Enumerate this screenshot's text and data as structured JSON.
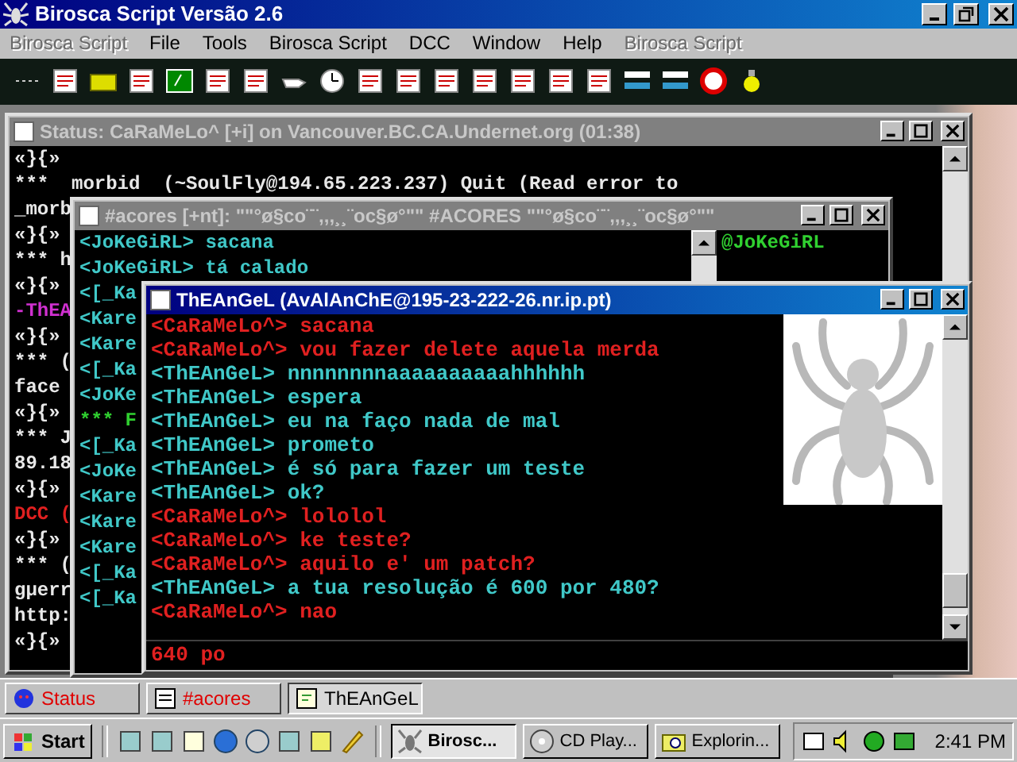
{
  "app": {
    "title": "Birosca Script Versão 2.6"
  },
  "menu": [
    {
      "label": "Birosca Script",
      "disabled": true
    },
    {
      "label": "File",
      "disabled": false
    },
    {
      "label": "Tools",
      "disabled": false
    },
    {
      "label": "Birosca Script",
      "disabled": false
    },
    {
      "label": "DCC",
      "disabled": false
    },
    {
      "label": "Window",
      "disabled": false
    },
    {
      "label": "Help",
      "disabled": false
    },
    {
      "label": "Birosca Script",
      "disabled": true
    }
  ],
  "status_window": {
    "title": "Status: CaRaMeLo^ [+i] on Vancouver.BC.CA.Undernet.org (01:38)",
    "active": false,
    "lines": [
      {
        "text": "«}{»",
        "color": "#e8e8e8"
      },
      {
        "text": "***  morbid  (~SoulFly@194.65.223.237) Quit (Read error to",
        "color": "#e8e8e8"
      },
      {
        "text": "_morb",
        "color": "#e8e8e8"
      },
      {
        "text": "«}{»",
        "color": "#e8e8e8"
      },
      {
        "text": "*** h",
        "color": "#e8e8e8"
      },
      {
        "text": "«}{»",
        "color": "#e8e8e8"
      },
      {
        "text": "-ThEA",
        "color": "#d030d0"
      },
      {
        "text": "«}{»",
        "color": "#e8e8e8"
      },
      {
        "text": "*** (",
        "color": "#e8e8e8"
      },
      {
        "text": "face",
        "color": "#e8e8e8"
      },
      {
        "text": "«}{»",
        "color": "#e8e8e8"
      },
      {
        "text": "*** J",
        "color": "#e8e8e8"
      },
      {
        "text": "89.18",
        "color": "#e8e8e8"
      },
      {
        "text": "«}{»",
        "color": "#e8e8e8"
      },
      {
        "text": "DCC (",
        "color": "#e02020"
      },
      {
        "text": "«}{»",
        "color": "#e8e8e8"
      },
      {
        "text": "*** (",
        "color": "#e8e8e8"
      },
      {
        "text": "gμerr",
        "color": "#e8e8e8"
      },
      {
        "text": "http:",
        "color": "#e8e8e8"
      },
      {
        "text": "«}{»",
        "color": "#e8e8e8"
      }
    ]
  },
  "channel_window": {
    "title": "#acores [+nt]: \"\"°ø§co¨¨,,,¸¸¨oc§ø°\"\" #ACORES \"\"°ø§co¨¨,,,¸¸¨oc§ø°\"\"",
    "active": false,
    "lines": [
      {
        "text": "<JoKeGiRL> sacana",
        "color": "#40c8c8"
      },
      {
        "text": "<JoKeGiRL> tá calado",
        "color": "#40c8c8"
      },
      {
        "text": "<[_Ka",
        "color": "#40c8c8"
      },
      {
        "text": "<Kare",
        "color": "#40c8c8"
      },
      {
        "text": "<Kare",
        "color": "#40c8c8"
      },
      {
        "text": "<[_Ka",
        "color": "#40c8c8"
      },
      {
        "text": "<JoKe",
        "color": "#40c8c8"
      },
      {
        "text": "*** F",
        "color": "#30d030"
      },
      {
        "text": "<[_Ka",
        "color": "#40c8c8"
      },
      {
        "text": "<JoKe",
        "color": "#40c8c8"
      },
      {
        "text": "<Kare",
        "color": "#40c8c8"
      },
      {
        "text": "<Kare",
        "color": "#40c8c8"
      },
      {
        "text": "<Kare",
        "color": "#40c8c8"
      },
      {
        "text": "<[_Ka",
        "color": "#40c8c8"
      },
      {
        "text": "<[_Ka",
        "color": "#40c8c8"
      }
    ],
    "nicklist": [
      {
        "nick": "@JoKeGiRL",
        "selected": false
      }
    ]
  },
  "query_window": {
    "title": "ThEAnGeL (AvAlAnChE@195-23-222-26.nr.ip.pt)",
    "active": true,
    "lines": [
      {
        "text": "<CaRaMeLo^> sacana",
        "color": "#e02020"
      },
      {
        "text": "<CaRaMeLo^> vou fazer delete aquela merda",
        "color": "#e02020"
      },
      {
        "text": "<ThEAnGeL> nnnnnnnnaaaaaaaaaahhhhhh",
        "color": "#40c8c8"
      },
      {
        "text": "<ThEAnGeL> espera",
        "color": "#40c8c8"
      },
      {
        "text": "<ThEAnGeL> eu na faço nada de mal",
        "color": "#40c8c8"
      },
      {
        "text": "<ThEAnGeL> prometo",
        "color": "#40c8c8"
      },
      {
        "text": "<ThEAnGeL> é só para fazer um teste",
        "color": "#40c8c8"
      },
      {
        "text": "<ThEAnGeL> ok?",
        "color": "#40c8c8"
      },
      {
        "text": "<CaRaMeLo^> lololol",
        "color": "#e02020"
      },
      {
        "text": "<CaRaMeLo^> ke teste?",
        "color": "#e02020"
      },
      {
        "text": "<CaRaMeLo^> aquilo e' um patch?",
        "color": "#e02020"
      },
      {
        "text": "<ThEAnGeL> a tua resolução é 600 por 480?",
        "color": "#40c8c8"
      },
      {
        "text": "<CaRaMeLo^> nao",
        "color": "#e02020"
      }
    ],
    "input": {
      "value": "640 po"
    }
  },
  "switchbar": [
    {
      "label": "Status",
      "kind": "status",
      "highlighted": true,
      "selected": false
    },
    {
      "label": "#acores",
      "kind": "channel",
      "highlighted": true,
      "selected": false
    },
    {
      "label": "ThEAnGeL",
      "kind": "query",
      "highlighted": false,
      "selected": true
    }
  ],
  "taskbar": {
    "start": "Start",
    "tasks": [
      {
        "label": "Birosc...",
        "kind": "app",
        "selected": true
      },
      {
        "label": "CD Play...",
        "kind": "cd",
        "selected": false
      },
      {
        "label": "Explorin...",
        "kind": "explorer",
        "selected": false
      }
    ],
    "clock": "2:41 PM"
  }
}
